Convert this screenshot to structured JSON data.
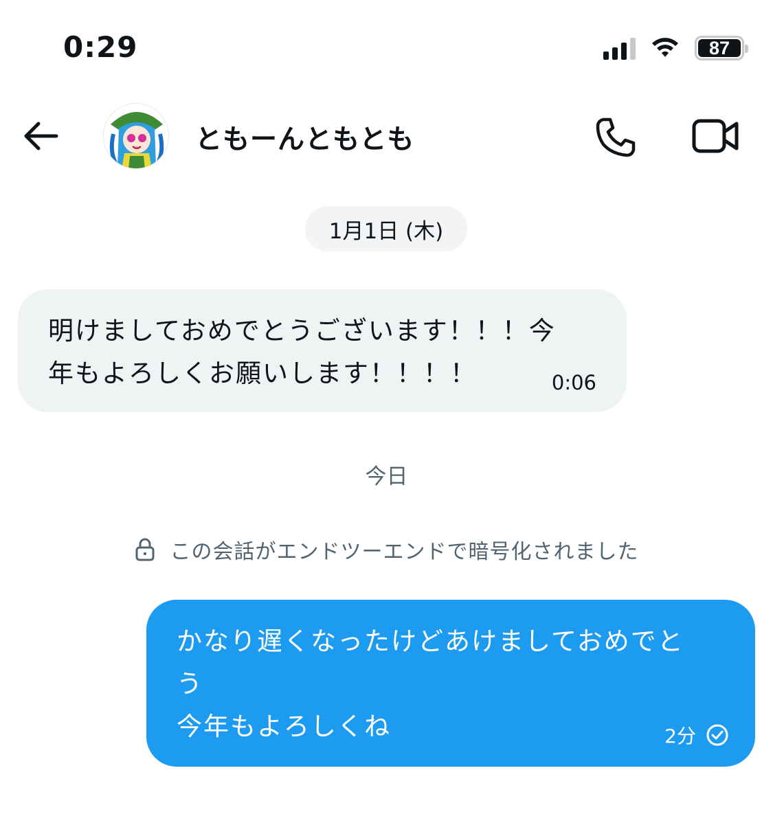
{
  "status_bar": {
    "time": "0:29",
    "battery": "87",
    "signal_icon": "cellular-signal-icon",
    "wifi_icon": "wifi-icon"
  },
  "header": {
    "contact_name": "ともーんともとも",
    "back_icon": "back-arrow-icon",
    "call_icon": "phone-icon",
    "video_icon": "video-camera-icon"
  },
  "conversation": {
    "date_divider": "1月1日 (木)",
    "received_message": {
      "text": "明けましておめでとうございます！！！今\n年もよろしくお願いします！！！！",
      "time": "0:06"
    },
    "today_label": "今日",
    "encryption_notice": "この会話がエンドツーエンドで暗号化されました",
    "sent_message": {
      "text": "かなり遅くなったけどあけましておめでと\nう\n今年もよろしくね",
      "time": "2分",
      "status_icon": "read-check-icon"
    }
  },
  "colors": {
    "accent": "#1d9bf0",
    "received_bubble": "#eff3f4",
    "muted_text": "#536471"
  }
}
